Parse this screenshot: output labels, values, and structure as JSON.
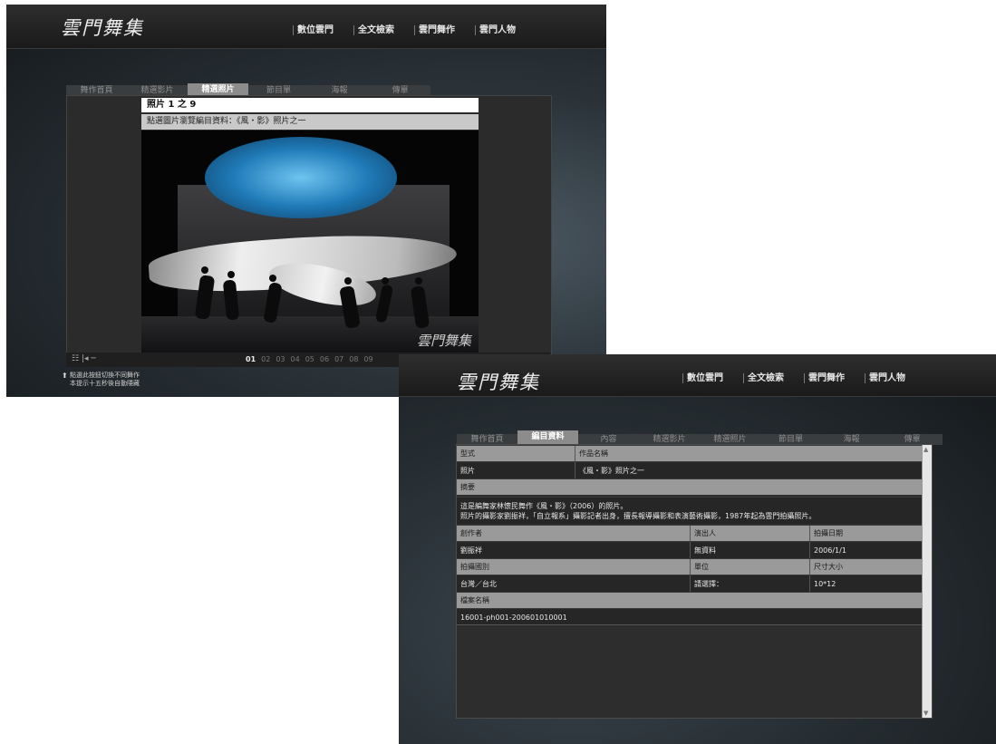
{
  "window1": {
    "logo": "雲門舞集",
    "top_nav": [
      "數位雲門",
      "全文檢索",
      "雲門舞作",
      "雲門人物"
    ],
    "tabs": [
      {
        "label": "舞作首頁",
        "active": false
      },
      {
        "label": "精選影片",
        "active": false
      },
      {
        "label": "精選照片",
        "active": true
      },
      {
        "label": "節目單",
        "active": false
      },
      {
        "label": "海報",
        "active": false
      },
      {
        "label": "傳單",
        "active": false
      }
    ],
    "photo_counter": "照片 1 之 9",
    "photo_caption": "點選圖片瀏覽編目資料：《風・影》照片之一",
    "watermark": "雲門舞集",
    "bar_icons": "☷  |◂ ─",
    "pages": [
      "01",
      "02",
      "03",
      "04",
      "05",
      "06",
      "07",
      "08",
      "09"
    ],
    "current_page": "01",
    "hint_line1": "點選此按鈕切換不同舞作",
    "hint_line2": "本提示十五秒後自動隱藏"
  },
  "window2": {
    "logo": "雲門舞集",
    "top_nav": [
      "數位雲門",
      "全文檢索",
      "雲門舞作",
      "雲門人物"
    ],
    "tabs": [
      {
        "label": "舞作首頁",
        "active": false
      },
      {
        "label": "編目資料",
        "active": true
      },
      {
        "label": "內容",
        "active": false
      },
      {
        "label": "精選影片",
        "active": false
      },
      {
        "label": "精選照片",
        "active": false
      },
      {
        "label": "節目單",
        "active": false
      },
      {
        "label": "海報",
        "active": false
      },
      {
        "label": "傳單",
        "active": false
      }
    ],
    "catalog": {
      "type_label": "型式",
      "work_label": "作品名稱",
      "type_value": "照片",
      "work_value": "《風・影》照片之一",
      "summary_label": "摘要",
      "summary_line1": "這是編舞家林懷民舞作《風・影》（2006）的照片。",
      "summary_line2": "照片的攝影家劉振祥，「自立報系」攝影記者出身，擅長報導攝影和表演藝術攝影，1987年起為雲門拍攝照片。",
      "creator_label": "創作者",
      "performer_label": "演出人",
      "date_label": "拍攝日期",
      "creator_value": "劉振祥",
      "performer_value": "無資料",
      "date_value": "2006/1/1",
      "location_label": "拍攝國別",
      "unit_label": "單位",
      "size_label": "尺寸大小",
      "location_value": "台灣／台北",
      "unit_value": "請選擇：",
      "size_value": "10*12",
      "filename_label": "檔案名稱",
      "filename_value": "16001-ph001-200601010001"
    }
  },
  "colors": {
    "header": "#1f1f1f",
    "active_tab": "#8c8c8c",
    "label_row": "#9a9a9a",
    "value_row": "#262626",
    "stage_blue": "#2a8fd0"
  }
}
